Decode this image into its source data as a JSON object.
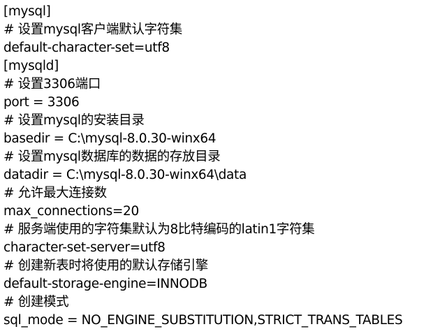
{
  "lines": [
    "[mysql]",
    "# 设置mysql客户端默认字符集",
    "default-character-set=utf8",
    "[mysqld]",
    "# 设置3306端口",
    "port = 3306",
    "# 设置mysql的安装目录",
    "basedir = C:\\mysql-8.0.30-winx64",
    "# 设置mysql数据库的数据的存放目录",
    "datadir = C:\\mysql-8.0.30-winx64\\data",
    "# 允许最大连接数",
    "max_connections=20",
    "# 服务端使用的字符集默认为8比特编码的latin1字符集",
    "character-set-server=utf8",
    "# 创建新表时将使用的默认存储引擎",
    "default-storage-engine=INNODB",
    "# 创建模式",
    "sql_mode = NO_ENGINE_SUBSTITUTION,STRICT_TRANS_TABLES"
  ]
}
